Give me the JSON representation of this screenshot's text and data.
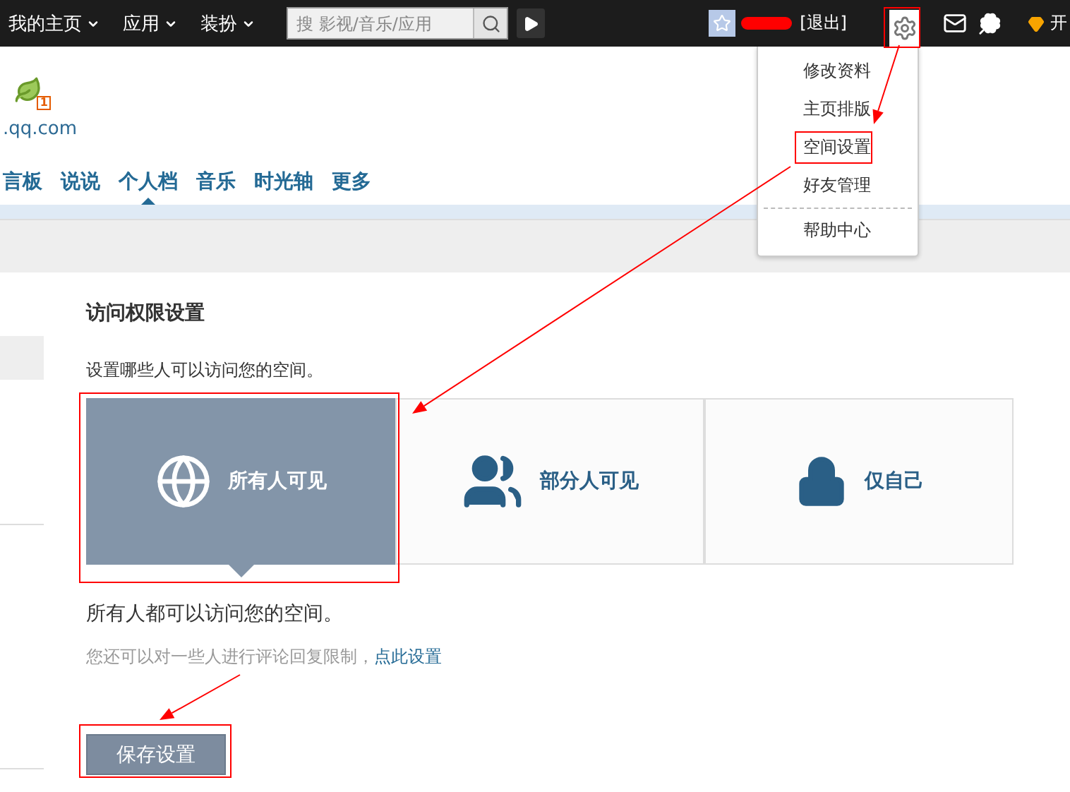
{
  "top_bar": {
    "menus": [
      {
        "label": "我的主页"
      },
      {
        "label": "应用"
      },
      {
        "label": "装扮"
      }
    ],
    "search": {
      "placeholder": "搜 影视/音乐/应用"
    },
    "logout": "[退出]",
    "vip": "开"
  },
  "settings_menu": {
    "items": [
      {
        "label": "修改资料",
        "selected": false
      },
      {
        "label": "主页排版",
        "selected": false
      },
      {
        "label": "空间设置",
        "selected": true
      },
      {
        "label": "好友管理",
        "selected": false
      },
      {
        "label": "帮助中心",
        "selected": false
      }
    ]
  },
  "profile": {
    "badge": "1",
    "url": ".qq.com"
  },
  "nav_tabs": [
    {
      "label": "言板",
      "selected": false
    },
    {
      "label": "说说",
      "selected": false
    },
    {
      "label": "个人档",
      "selected": true
    },
    {
      "label": "音乐",
      "selected": false
    },
    {
      "label": "时光轴",
      "selected": false
    },
    {
      "label": "更多",
      "selected": false
    }
  ],
  "access": {
    "title": "访问权限设置",
    "subtitle": "设置哪些人可以访问您的空间。",
    "options": [
      {
        "kind": "globe",
        "label": "所有人可见",
        "selected": true
      },
      {
        "kind": "people",
        "label": "部分人可见",
        "selected": false
      },
      {
        "kind": "lock",
        "label": "仅自己",
        "selected": false
      }
    ],
    "description": "所有人都可以访问您的空间。",
    "hint": "您还可以对一些人进行评论回复限制，",
    "hint_link": "点此设置",
    "save_button": "保存设置"
  }
}
